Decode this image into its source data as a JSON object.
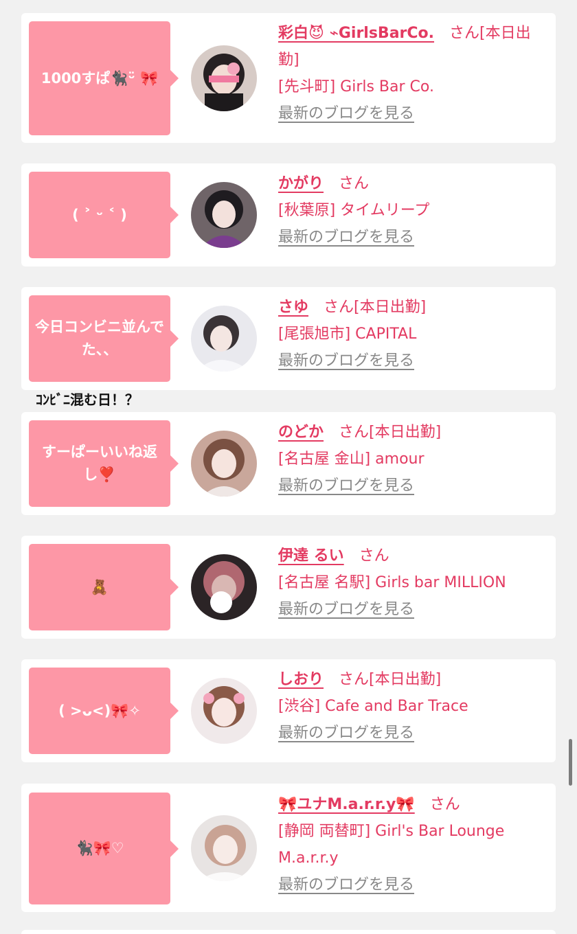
{
  "entries": [
    {
      "bubble": "1000すぱ🐈‍⬛ᵕ̈ 🎀",
      "name": "彩白😈 ⌁GirlsBarCo.",
      "suffix": "さん[本日出勤]",
      "shop": "[先斗町] Girls Bar Co.",
      "blog_link": "最新のブログを見る"
    },
    {
      "bubble": "( ˃ ᵕ ˂ )",
      "name": "かがり",
      "suffix": "さん",
      "shop": "[秋葉原] タイムリープ",
      "blog_link": "最新のブログを見る"
    },
    {
      "bubble": "今日コンビニ並んでた、、",
      "name": "さゆ",
      "suffix": "さん[本日出勤]",
      "shop": "[尾張旭市] CAPITAL",
      "blog_link": "最新のブログを見る"
    },
    {
      "bubble": "すーぱーいいね返し❣️",
      "name": "のどか",
      "suffix": "さん[本日出勤]",
      "shop": "[名古屋 金山] amour",
      "blog_link": "最新のブログを見る"
    },
    {
      "bubble": "🧸",
      "name": "伊達 るい",
      "suffix": "さん",
      "shop": "[名古屋 名駅] Girls bar MILLION",
      "blog_link": "最新のブログを見る"
    },
    {
      "bubble": "( >ᴗ<)🎀✧",
      "name": "しおり",
      "suffix": "さん[本日出勤]",
      "shop": "[渋谷] Cafe and Bar Trace",
      "blog_link": "最新のブログを見る"
    },
    {
      "bubble": "🐈‍⬛🎀♡",
      "name": "🎀ユナM.a.r.r.y🎀",
      "suffix": "さん",
      "shop": "[静岡 両替町] Girl's Bar Lounge M.a.r.r.y",
      "blog_link": "最新のブログを見る"
    }
  ],
  "overflow_caption": "ｺﾝﾋﾞﾆ混む日！？",
  "colors": {
    "background": "#f1f1f1",
    "card": "#ffffff",
    "bubble": "#fd97a6",
    "accent_text": "#e33a61",
    "link_gray": "#888888"
  }
}
